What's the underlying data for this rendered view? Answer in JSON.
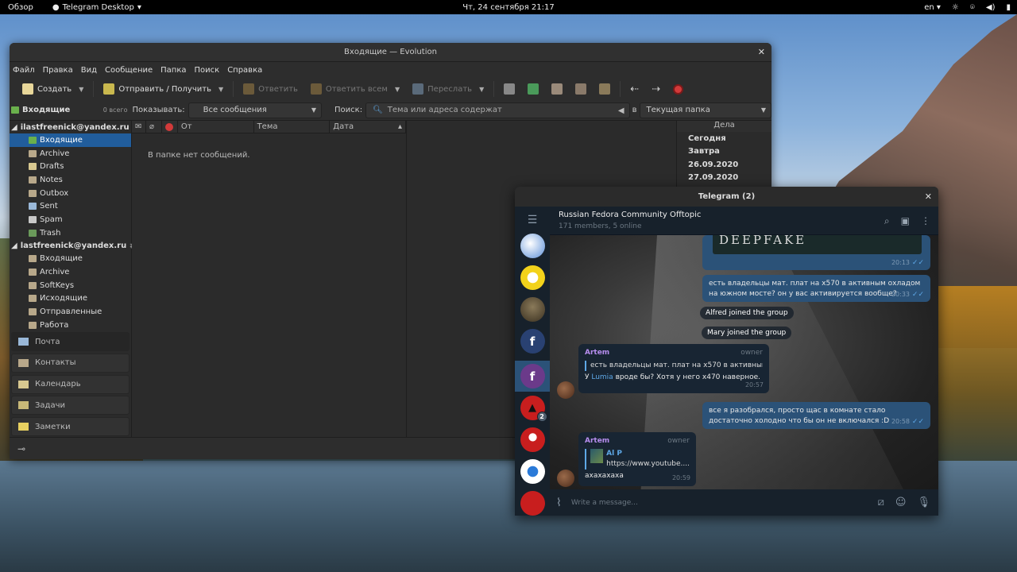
{
  "topbar": {
    "activities": "Обзор",
    "app_name": "Telegram Desktop",
    "clock": "Чт, 24 сентября  21:17",
    "lang": "en"
  },
  "evolution": {
    "title": "Входящие — Evolution",
    "menu": [
      "Файл",
      "Правка",
      "Вид",
      "Сообщение",
      "Папка",
      "Поиск",
      "Справка"
    ],
    "toolbar": {
      "create": "Создать",
      "send_receive": "Отправить / Получить",
      "reply": "Ответить",
      "reply_all": "Ответить всем",
      "forward": "Переслать"
    },
    "search": {
      "folder": "Входящие",
      "count": "0 всего",
      "show_label": "Показывать:",
      "show_value": "Все сообщения",
      "search_label": "Поиск:",
      "search_placeholder": "Тема или адреса содержат",
      "in_label": "в",
      "scope": "Текущая папка"
    },
    "accounts": [
      {
        "name": "ilastfreenick@yandex.ru",
        "folders": [
          "Входящие",
          "Archive",
          "Drafts",
          "Notes",
          "Outbox",
          "Sent",
          "Spam",
          "Trash"
        ]
      },
      {
        "name": "lastfreenick@yandex.ru",
        "folders": [
          "Входящие",
          "Archive",
          "SoftKeys",
          "Исходящие",
          "Отправленные",
          "Работа"
        ]
      }
    ],
    "switcher": [
      "Почта",
      "Контакты",
      "Календарь",
      "Задачи",
      "Заметки"
    ],
    "columns": {
      "from": "От",
      "subject": "Тема",
      "date": "Дата"
    },
    "empty": "В папке нет сообщений.",
    "tasks": {
      "header": "Дела",
      "items": [
        "Сегодня",
        "Завтра",
        "26.09.2020",
        "27.09.2020"
      ]
    }
  },
  "telegram": {
    "title": "Telegram (2)",
    "chat_name": "Russian Fedora Community Offtopic",
    "chat_sub": "171 members, 5 online",
    "unread_badge": "2",
    "video_caption": "DEEPFAKE",
    "messages": {
      "m1_time": "20:13",
      "m2_text": "есть владельцы мат. плат на x570 в активным охладом на южном мосте? он у вас активируется вообще?",
      "m2_time": "20:33",
      "svc1": "Alfred joined the group",
      "svc2": "Mary joined the group",
      "m3_sender": "Artem",
      "m3_role": "owner",
      "m3_reply_text": "есть владельцы мат. плат на x570 в активным ох...",
      "m3_text_pre": "У ",
      "m3_link": "Lumia",
      "m3_text_post": " вроде бы? Хотя у него x470 наверное.",
      "m3_time": "20:57",
      "m4_text": "все я разобрался, просто щас в комнате стало достаточно холодно что бы он не включался :D",
      "m4_time": "20:58",
      "m5_sender": "Artem",
      "m5_role": "owner",
      "m5_reply_name": "Al P",
      "m5_reply_text": "https://www.youtube....",
      "m5_text": "ахахахаха",
      "m5_time": "20:59"
    },
    "composer_placeholder": "Write a message..."
  }
}
